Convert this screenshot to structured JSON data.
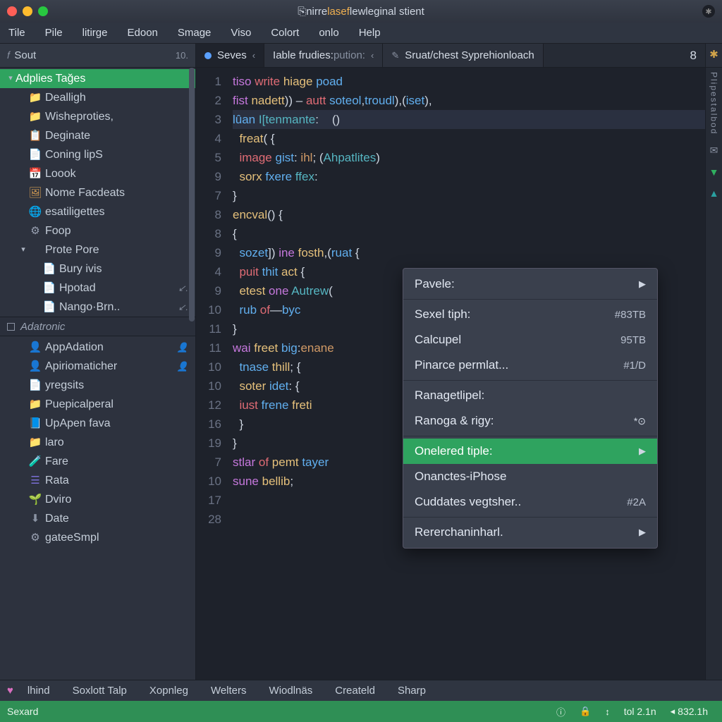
{
  "titlebar": {
    "prefix_icon": "⎘",
    "prefix": "nirre",
    "highlight": "lasef",
    "mid": "lew",
    "rest": "leginal stient"
  },
  "menubar": [
    "Tile",
    "Pile",
    "litirge",
    "Edoon",
    "Smage",
    "Viso",
    "Colort",
    "onlo",
    "Help"
  ],
  "project_header": {
    "icon": "𝑓",
    "label": "Sout",
    "count": "10."
  },
  "tabs": [
    {
      "icon": "dot",
      "label": "Seves",
      "active": true,
      "chevron": true
    },
    {
      "label_main": "Iable frudies:",
      "label_dim": "pution:",
      "chevron": true
    },
    {
      "icon": "pen",
      "label": "Sruat/chest Syprehionloach"
    }
  ],
  "tab_badge": "8",
  "right_gutter_label": "Plipestalbod",
  "sidebar": {
    "section1": {
      "root": {
        "label": "Adplies Tağes",
        "selected": true
      },
      "items": [
        {
          "icon": "folder",
          "label": "Dealligh"
        },
        {
          "icon": "folder",
          "label": "Wisheproties,"
        },
        {
          "icon": "clip",
          "label": "Deginate"
        },
        {
          "icon": "file",
          "label": "Coning lipS"
        },
        {
          "icon": "cal",
          "label": "Loook"
        },
        {
          "icon": "img",
          "label": "Nome Facdeats"
        },
        {
          "icon": "globe",
          "label": "esatiligettes"
        },
        {
          "icon": "gear",
          "label": "Foop"
        },
        {
          "icon": "exp",
          "label": "Prote Pore",
          "expandable": true
        },
        {
          "icon": "file-r",
          "label": "Bury ivis",
          "depth": 2
        },
        {
          "icon": "file-r",
          "label": "Hpotad",
          "depth": 2,
          "meta": "↙."
        },
        {
          "icon": "file-r",
          "label": "Nango·Brn..",
          "depth": 2,
          "meta": "↙."
        }
      ]
    },
    "section2": {
      "header": "Adatronic",
      "items": [
        {
          "icon": "bust",
          "label": "AppAdation",
          "meta": "👤"
        },
        {
          "icon": "bust",
          "label": "Apiriomaticher",
          "meta": "👤"
        },
        {
          "icon": "file-r",
          "label": "yregsits"
        },
        {
          "icon": "folder2",
          "label": "Puepicalperal"
        },
        {
          "icon": "blue",
          "label": "UpApen fava"
        },
        {
          "icon": "folder2",
          "label": "laro"
        },
        {
          "icon": "beaker",
          "label": "Fare"
        },
        {
          "icon": "list",
          "label": "Rata"
        },
        {
          "icon": "seed",
          "label": "Dviro"
        },
        {
          "icon": "mark",
          "label": "Date"
        },
        {
          "icon": "gear",
          "label": "gateeSmpl"
        }
      ]
    }
  },
  "gutter_lines": [
    "1",
    "2",
    "3",
    "4",
    "5",
    "9",
    "7",
    "8",
    "8",
    "9",
    "4",
    "9",
    "10",
    "11",
    "11",
    "10",
    "10",
    "12",
    "16",
    "19",
    "7",
    "10",
    "17",
    "28"
  ],
  "code_lines": [
    [
      [
        "kw",
        "tiso"
      ],
      [
        "op",
        " "
      ],
      [
        "kw2",
        "write"
      ],
      [
        "op",
        " "
      ],
      [
        "fn",
        "hiage"
      ],
      [
        "op",
        " "
      ],
      [
        "id",
        "poad"
      ]
    ],
    [
      [
        "kw",
        "fist"
      ],
      [
        "op",
        " "
      ],
      [
        "fn",
        "nadett"
      ],
      [
        "op",
        ")) – "
      ],
      [
        "kw2",
        "autt"
      ],
      [
        "op",
        " "
      ],
      [
        "id",
        "soteol"
      ],
      [
        "op",
        ","
      ],
      [
        "id",
        "troudl"
      ],
      [
        "op",
        ")"
      ],
      [
        "op",
        ",("
      ],
      [
        "id",
        "iset"
      ],
      [
        "op",
        "),"
      ]
    ],
    [
      [
        "id",
        "lûan"
      ],
      [
        "op",
        " "
      ],
      [
        "ty",
        "I[tenmante"
      ],
      [
        "op",
        ":    ()"
      ]
    ],
    [
      [
        "op",
        "  "
      ],
      [
        "fn",
        "freat"
      ],
      [
        "op",
        "( {"
      ]
    ],
    [
      [
        "op",
        "  "
      ],
      [
        "kw2",
        "image"
      ],
      [
        "op",
        " "
      ],
      [
        "id",
        "gist"
      ],
      [
        "op",
        ": "
      ],
      [
        "pr",
        "ihl"
      ],
      [
        "op",
        "; ("
      ],
      [
        "ty",
        "Ahpatlites"
      ],
      [
        "op",
        ")"
      ]
    ],
    [
      [
        "op",
        "  "
      ],
      [
        "fn",
        "sorx"
      ],
      [
        "op",
        " "
      ],
      [
        "id",
        "fxere"
      ],
      [
        "op",
        " "
      ],
      [
        "ty",
        "ffex"
      ],
      [
        "op",
        ":"
      ]
    ],
    [
      [
        "op",
        "}"
      ]
    ],
    [
      [
        "fn",
        "encval"
      ],
      [
        "op",
        "() {"
      ]
    ],
    [
      [
        "op",
        "{"
      ]
    ],
    [
      [
        "op",
        "  "
      ],
      [
        "id",
        "sozet"
      ],
      [
        "op",
        "]) "
      ],
      [
        "kw",
        "ine"
      ],
      [
        "op",
        " "
      ],
      [
        "fn",
        "fosth"
      ],
      [
        "op",
        ",("
      ],
      [
        "id",
        "ruat"
      ],
      [
        "op",
        " {"
      ]
    ],
    [
      [
        "op",
        "  "
      ],
      [
        "kw2",
        "puit"
      ],
      [
        "op",
        " "
      ],
      [
        "id",
        "thit"
      ],
      [
        "op",
        " "
      ],
      [
        "fn",
        "act"
      ],
      [
        "op",
        " {"
      ]
    ],
    [
      [
        "op",
        "  "
      ],
      [
        "fn",
        "etest"
      ],
      [
        "op",
        " "
      ],
      [
        "kw",
        "one"
      ],
      [
        "op",
        " "
      ],
      [
        "ty",
        "Autrew"
      ],
      [
        "op",
        "("
      ]
    ],
    [
      [
        "op",
        "  "
      ],
      [
        "id",
        "rub"
      ],
      [
        "op",
        " "
      ],
      [
        "kw2",
        "of"
      ],
      [
        "op",
        "—"
      ],
      [
        "id",
        "byc"
      ]
    ],
    [
      [
        "op",
        "}"
      ]
    ],
    [
      [
        "kw",
        "wai"
      ],
      [
        "op",
        " "
      ],
      [
        "fn",
        "freet"
      ],
      [
        "op",
        " "
      ],
      [
        "id",
        "big"
      ],
      [
        "op",
        ":"
      ],
      [
        "pr",
        "enane"
      ]
    ],
    [
      [
        "op",
        ""
      ]
    ],
    [
      [
        "op",
        "  "
      ],
      [
        "id",
        "tnase"
      ],
      [
        "op",
        " "
      ],
      [
        "fn",
        "thill"
      ],
      [
        "op",
        "; {"
      ]
    ],
    [
      [
        "op",
        "  "
      ],
      [
        "fn",
        "soter"
      ],
      [
        "op",
        " "
      ],
      [
        "id",
        "idet"
      ],
      [
        "op",
        ": {"
      ]
    ],
    [
      [
        "op",
        "  "
      ],
      [
        "kw2",
        "iust"
      ],
      [
        "op",
        " "
      ],
      [
        "id",
        "frene"
      ],
      [
        "op",
        " "
      ],
      [
        "fn",
        "freti"
      ]
    ],
    [
      [
        "op",
        "  }"
      ]
    ],
    [
      [
        "op",
        "}"
      ]
    ],
    [
      [
        "kw",
        "stlar"
      ],
      [
        "op",
        " "
      ],
      [
        "kw2",
        "of"
      ],
      [
        "op",
        " "
      ],
      [
        "fn",
        "pemt"
      ],
      [
        "op",
        " "
      ],
      [
        "id",
        "tayer"
      ]
    ],
    [
      [
        "kw",
        "sune"
      ],
      [
        "op",
        " "
      ],
      [
        "fn",
        "bellib"
      ],
      [
        "op",
        ";"
      ]
    ],
    [
      [
        "op",
        ""
      ]
    ]
  ],
  "context_menu": {
    "groups": [
      [
        {
          "label": "Pavele:",
          "arrow": true
        }
      ],
      [
        {
          "label": "Sexel tiph:",
          "shortcut": "#83TB"
        },
        {
          "label": "Calcupel",
          "shortcut": "95TB"
        },
        {
          "label": "Pinarce permlat...",
          "shortcut": "#1/D"
        }
      ],
      [
        {
          "label": "Ranagetlipel:"
        },
        {
          "label": "Ranoga & rigy:",
          "clock": true
        }
      ],
      [
        {
          "label": "Onelered tiple:",
          "arrow": true,
          "hover": true
        },
        {
          "label": "Onanctes-iPhose"
        },
        {
          "label": "Cuddates vegtsher..",
          "shortcut": "#2A"
        }
      ],
      [
        {
          "label": "Rererchaninharl.",
          "arrow": true
        }
      ]
    ]
  },
  "status1": {
    "items": [
      "lhind",
      "Soxlott Talp",
      "Xopnleg",
      "Welters",
      "Wiodlnäs",
      "Createld",
      "Sharp"
    ]
  },
  "status2": {
    "left": "Sexard",
    "right": [
      {
        "icon": "ⓘ",
        "text": ""
      },
      {
        "icon": "🔒",
        "text": ""
      },
      {
        "icon": "↕",
        "text": ""
      },
      {
        "icon": "",
        "text": "tol 2.1n"
      },
      {
        "icon": "◂",
        "text": "832.1h"
      }
    ]
  }
}
